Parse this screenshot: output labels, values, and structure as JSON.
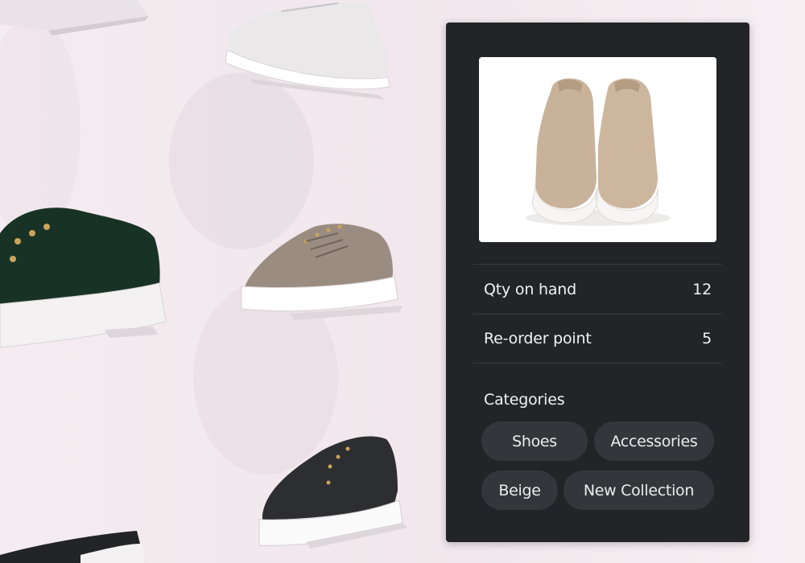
{
  "inventory": {
    "rows": [
      {
        "label": "Qty on hand",
        "value": "12"
      },
      {
        "label": "Re-order point",
        "value": "5"
      }
    ]
  },
  "categories": {
    "title": "Categories",
    "tags": [
      "Shoes",
      "Accessories",
      "Beige",
      "New Collection"
    ]
  },
  "colors": {
    "card_background": "#232428",
    "chip_background": "#35363b",
    "text": "#f2f2f2",
    "product": "#c8b29a"
  },
  "icons": {
    "background": "sneaker-wall-photo",
    "product": "beige-slip-on-shoe-photo"
  }
}
